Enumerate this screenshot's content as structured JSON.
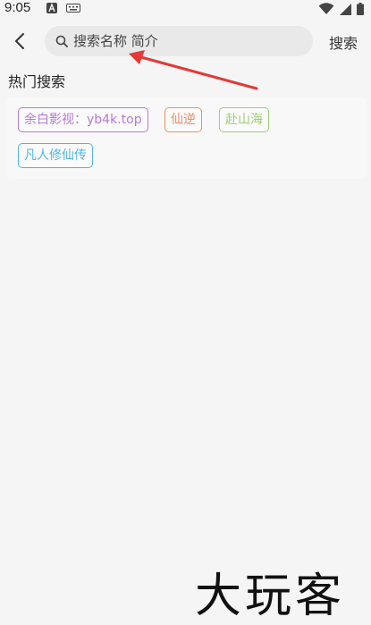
{
  "status_bar": {
    "time": "9:05"
  },
  "search": {
    "placeholder": "搜索名称 简介",
    "button_label": "搜索"
  },
  "hot_search": {
    "title": "热门搜索",
    "tags": [
      {
        "label": "余白影视：yb4k.top",
        "color": "#b57ad6"
      },
      {
        "label": "仙逆",
        "color": "#ee8e6a"
      },
      {
        "label": "赴山海",
        "color": "#9dcf74"
      },
      {
        "label": "凡人修仙传",
        "color": "#4fb7dd"
      }
    ]
  },
  "annotation": {
    "arrow_color": "#e53935"
  },
  "watermark": "大玩客"
}
